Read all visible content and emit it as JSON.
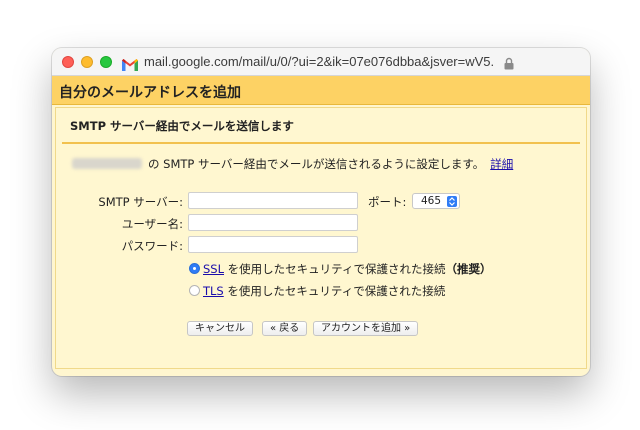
{
  "window": {
    "url": "mail.google.com/mail/u/0/?ui=2&ik=07e076dbba&jsver=wV5..."
  },
  "page": {
    "title": "自分のメールアドレスを追加"
  },
  "section": {
    "title": "SMTP サーバー経由でメールを送信します",
    "intro": "の SMTP サーバー経由でメールが送信されるように設定します。",
    "detail_link": "詳細"
  },
  "form": {
    "smtp_label": "SMTP サーバー:",
    "smtp_value": "",
    "port_label": "ポート:",
    "port_value": "465",
    "username_label": "ユーザー名:",
    "username_value": "",
    "password_label": "パスワード:",
    "password_value": ""
  },
  "security": {
    "ssl_link": "SSL",
    "ssl_text": "を使用したセキュリティで保護された接続",
    "ssl_recommended": "（推奨）",
    "ssl_checked": true,
    "tls_link": "TLS",
    "tls_text": "を使用したセキュリティで保護された接続",
    "tls_checked": false
  },
  "buttons": {
    "cancel": "キャンセル",
    "back": "« 戻る",
    "add_account": "アカウントを追加 »"
  },
  "colors": {
    "header": "#fdd264",
    "panel": "#fff7d0",
    "divider": "#f2c14e",
    "link": "#1a0dab",
    "radio_selected": "#2f7cf6"
  }
}
